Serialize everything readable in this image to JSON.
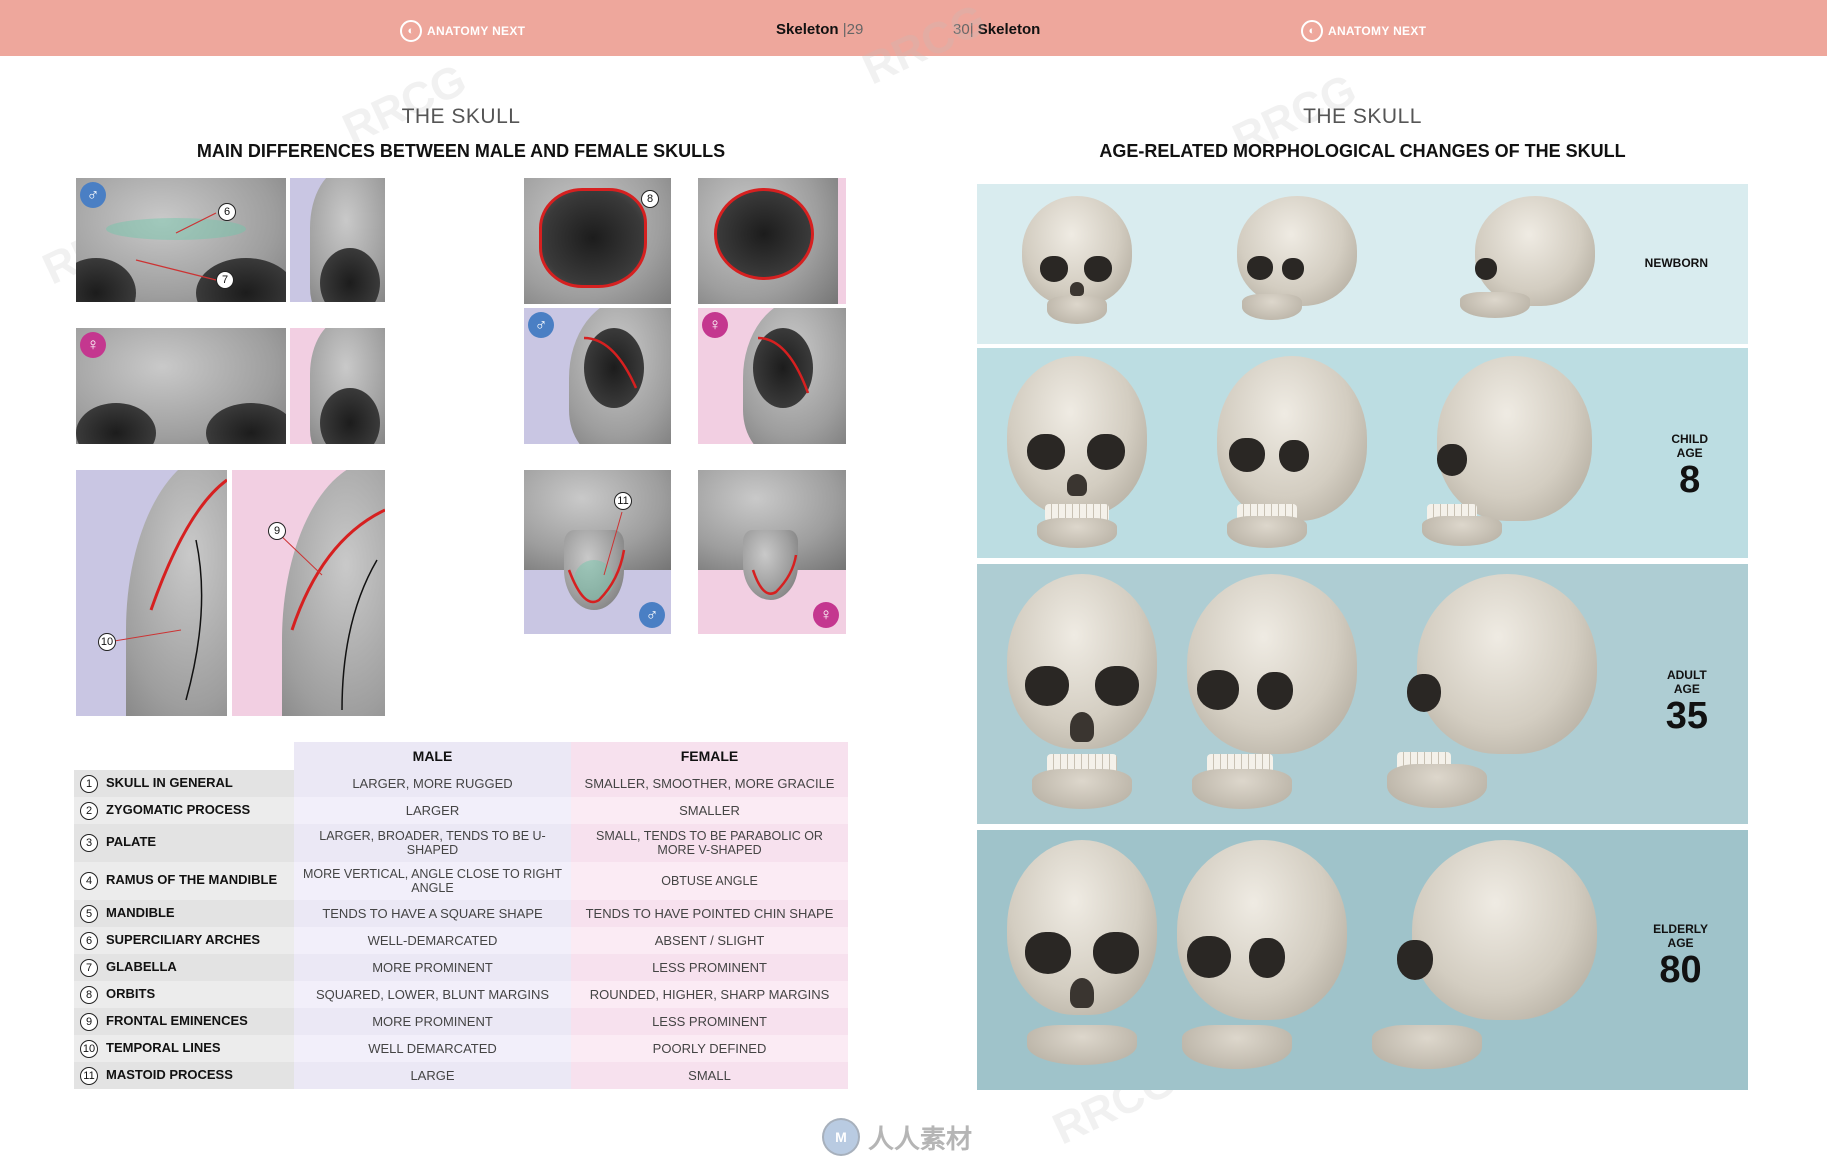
{
  "header": {
    "brand_left": "ANATOMY NEXT",
    "brand_right": "ANATOMY NEXT",
    "left_page_label": "Skeleton",
    "left_page_num": "29",
    "right_page_num": "30",
    "right_page_label": "Skeleton",
    "watermark": "RRCG"
  },
  "left": {
    "title": "THE SKULL",
    "subtitle": "MAIN DIFFERENCES BETWEEN MALE AND FEMALE SKULLS",
    "callouts": [
      "6",
      "7",
      "8",
      "9",
      "10",
      "11"
    ],
    "male_symbol": "♂",
    "female_symbol": "♀",
    "table": {
      "headers": [
        "",
        "MALE",
        "FEMALE"
      ],
      "rows": [
        {
          "n": "1",
          "feature": "SKULL IN GENERAL",
          "male": "LARGER, MORE RUGGED",
          "female": "SMALLER, SMOOTHER, MORE GRACILE"
        },
        {
          "n": "2",
          "feature": "ZYGOMATIC PROCESS",
          "male": "LARGER",
          "female": "SMALLER"
        },
        {
          "n": "3",
          "feature": "PALATE",
          "male": "LARGER, BROADER, TENDS TO BE U-SHAPED",
          "female": "SMALL, TENDS TO BE PARABOLIC OR MORE V-SHAPED"
        },
        {
          "n": "4",
          "feature": "RAMUS OF THE MANDIBLE",
          "male": "MORE VERTICAL, ANGLE CLOSE TO RIGHT ANGLE",
          "female": "OBTUSE ANGLE"
        },
        {
          "n": "5",
          "feature": "MANDIBLE",
          "male": "TENDS TO HAVE A SQUARE SHAPE",
          "female": "TENDS TO HAVE POINTED CHIN SHAPE"
        },
        {
          "n": "6",
          "feature": "SUPERCILIARY ARCHES",
          "male": "WELL-DEMARCATED",
          "female": "ABSENT / SLIGHT"
        },
        {
          "n": "7",
          "feature": "GLABELLA",
          "male": "MORE PROMINENT",
          "female": "LESS PROMINENT"
        },
        {
          "n": "8",
          "feature": "ORBITS",
          "male": "SQUARED, LOWER, BLUNT MARGINS",
          "female": "ROUNDED, HIGHER, SHARP MARGINS"
        },
        {
          "n": "9",
          "feature": "FRONTAL EMINENCES",
          "male": "MORE PROMINENT",
          "female": "LESS PROMINENT"
        },
        {
          "n": "10",
          "feature": "TEMPORAL LINES",
          "male": "WELL DEMARCATED",
          "female": "POORLY DEFINED"
        },
        {
          "n": "11",
          "feature": "MASTOID PROCESS",
          "male": "LARGE",
          "female": "SMALL"
        }
      ]
    }
  },
  "right": {
    "title": "THE SKULL",
    "subtitle": "AGE-RELATED MORPHOLOGICAL CHANGES OF THE SKULL",
    "bands": [
      {
        "label": "NEWBORN",
        "age_label": "",
        "age": "",
        "color": "#d9ecef"
      },
      {
        "label": "CHILD",
        "age_label": "AGE",
        "age": "8",
        "color": "#bcdde2"
      },
      {
        "label": "ADULT",
        "age_label": "AGE",
        "age": "35",
        "color": "#aecdd3"
      },
      {
        "label": "ELDERLY",
        "age_label": "AGE",
        "age": "80",
        "color": "#9fc3ca"
      }
    ]
  },
  "footer": {
    "logo_text": "人人素材"
  }
}
